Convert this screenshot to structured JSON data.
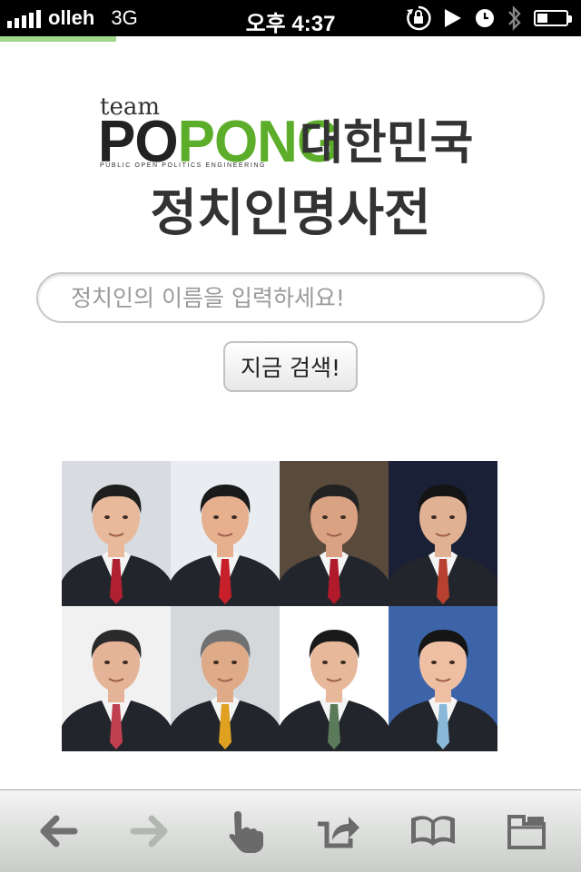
{
  "status_bar": {
    "carrier": "olleh",
    "network": "3G",
    "time": "오후 4:37",
    "battery_level": 0.35,
    "icons": [
      "orientation-lock-icon",
      "play-icon",
      "alarm-icon",
      "bluetooth-icon",
      "battery-icon"
    ]
  },
  "page_load_progress": 0.2,
  "logo": {
    "team": "team",
    "popong_part1": "PO",
    "popong_part2": "PONG",
    "tagline": "PUBLIC OPEN POLITICS ENGINEERING"
  },
  "title": {
    "line1": "대한민국",
    "line2": "정치인명사전"
  },
  "search": {
    "placeholder": "정치인의 이름을 입력하세요!",
    "value": "",
    "button_label": "지금 검색!"
  },
  "portraits": {
    "count": 8,
    "backgrounds": [
      "#d8dbe0",
      "#e9edf2",
      "#5a4a3c",
      "#1a2035",
      "#f1f1f1",
      "#d5d8db",
      "#ffffff",
      "#3d63a8"
    ],
    "tie_colors": [
      "#b02030",
      "#c8202a",
      "#b01a2a",
      "#b84030",
      "#c04050",
      "#e0a020",
      "#5a7a5a",
      "#8ab8d8"
    ]
  },
  "toolbar": {
    "buttons": [
      "back-icon",
      "forward-icon",
      "hand-pointer-icon",
      "share-icon",
      "bookmarks-icon",
      "tabs-icon"
    ]
  }
}
